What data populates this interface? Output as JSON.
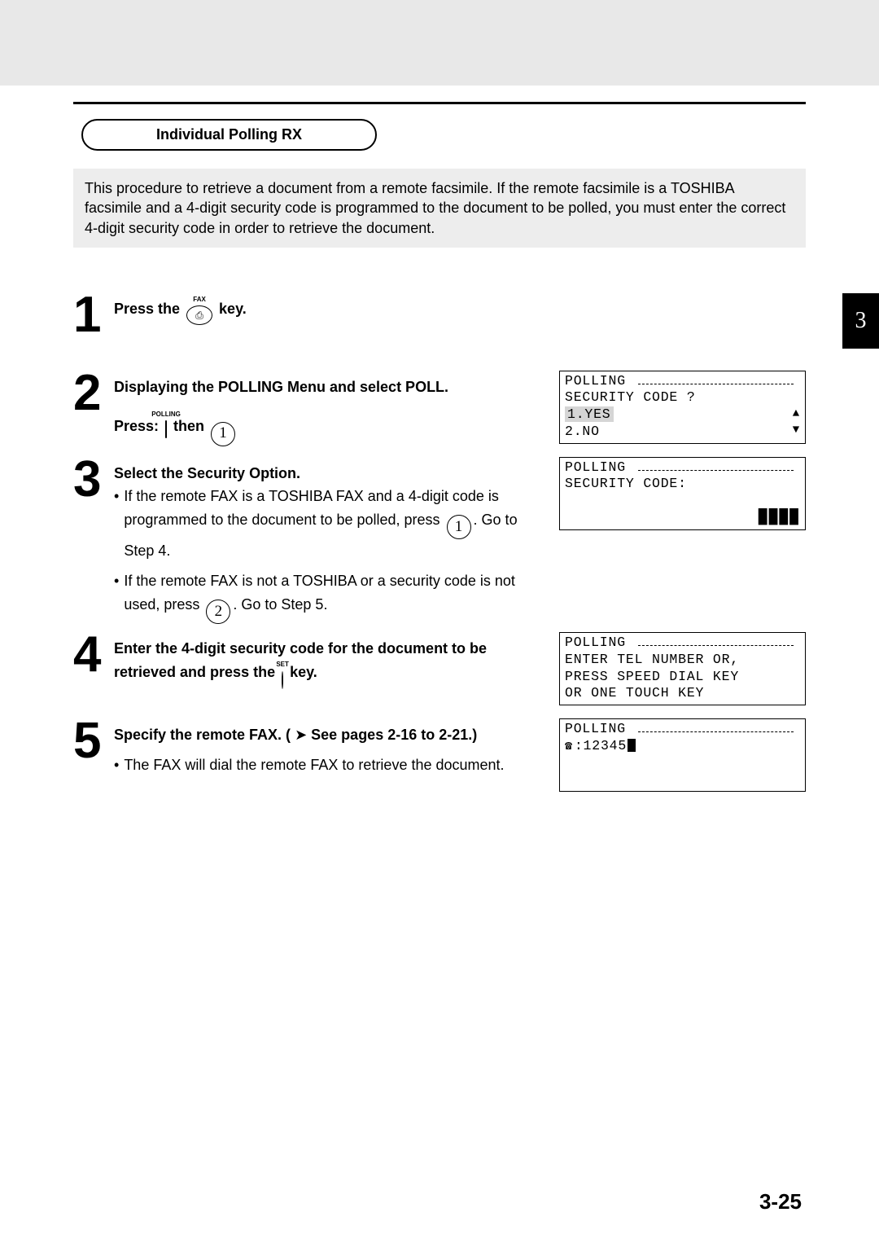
{
  "section_title": "Individual Polling RX",
  "intro": "This procedure to retrieve a document from a remote facsimile. If the remote facsimile is a TOSHIBA facsimile and a 4-digit security code is programmed to the document to be polled, you must enter the correct 4-digit security code in order to retrieve the document.",
  "chapter_tab": "3",
  "page_number": "3-25",
  "steps": {
    "s1": {
      "num": "1",
      "t1": "Press the ",
      "t2": " key.",
      "fax_label": "FAX"
    },
    "s2": {
      "num": "2",
      "t1": "Displaying the POLLING Menu and select POLL.",
      "press_label": "Press: ",
      "polling_label": "POLLING",
      "then_label": " then "
    },
    "s3": {
      "num": "3",
      "title": "Select the Security Option.",
      "b1a": "If the remote FAX is a TOSHIBA FAX and a 4-digit code is programmed to the document to be polled, press ",
      "b1b": ". Go to Step 4.",
      "b2a": "If the remote FAX is not a TOSHIBA or a security code is not used, press ",
      "b2b": ". Go to Step 5."
    },
    "s4": {
      "num": "4",
      "t1": "Enter the 4-digit security code for the document to be retrieved and press the ",
      "t2": " key.",
      "set_label": "SET"
    },
    "s5": {
      "num": "5",
      "t1": "Specify the remote FAX. ( ",
      "t2": " See pages 2-16 to 2-21.)",
      "note": "The FAX will dial the remote FAX to retrieve the document."
    }
  },
  "lcds": {
    "l2": {
      "line1": "POLLING",
      "line2": "SECURITY CODE ?",
      "line3": "1.YES",
      "line4": "2.NO"
    },
    "l3": {
      "line1": "POLLING",
      "line2": "SECURITY CODE:"
    },
    "l4": {
      "line1": "POLLING",
      "line2": "ENTER TEL NUMBER OR,",
      "line3": "PRESS SPEED DIAL KEY",
      "line4": "OR ONE TOUCH KEY"
    },
    "l5": {
      "line1": "POLLING",
      "line2_prefix": ":",
      "line2_value": "12345"
    }
  },
  "keys": {
    "one": "1",
    "two": "2",
    "fax_inner": "⎙"
  }
}
